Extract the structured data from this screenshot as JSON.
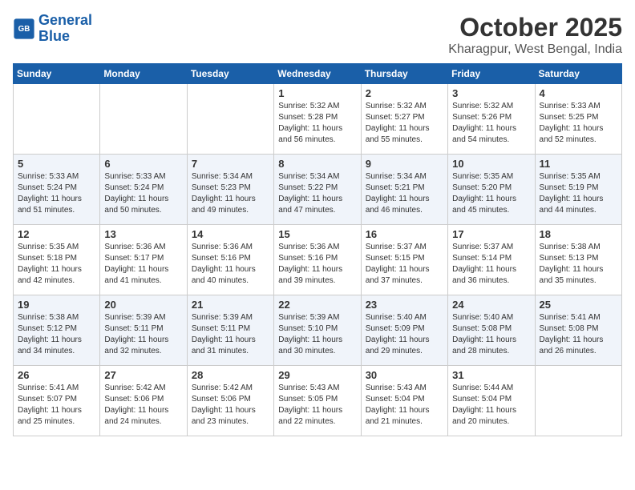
{
  "logo": {
    "text_general": "General",
    "text_blue": "Blue"
  },
  "header": {
    "title": "October 2025",
    "subtitle": "Kharagpur, West Bengal, India"
  },
  "weekdays": [
    "Sunday",
    "Monday",
    "Tuesday",
    "Wednesday",
    "Thursday",
    "Friday",
    "Saturday"
  ],
  "weeks": [
    [
      {
        "day": "",
        "sunrise": "",
        "sunset": "",
        "daylight": ""
      },
      {
        "day": "",
        "sunrise": "",
        "sunset": "",
        "daylight": ""
      },
      {
        "day": "",
        "sunrise": "",
        "sunset": "",
        "daylight": ""
      },
      {
        "day": "1",
        "sunrise": "Sunrise: 5:32 AM",
        "sunset": "Sunset: 5:28 PM",
        "daylight": "Daylight: 11 hours and 56 minutes."
      },
      {
        "day": "2",
        "sunrise": "Sunrise: 5:32 AM",
        "sunset": "Sunset: 5:27 PM",
        "daylight": "Daylight: 11 hours and 55 minutes."
      },
      {
        "day": "3",
        "sunrise": "Sunrise: 5:32 AM",
        "sunset": "Sunset: 5:26 PM",
        "daylight": "Daylight: 11 hours and 54 minutes."
      },
      {
        "day": "4",
        "sunrise": "Sunrise: 5:33 AM",
        "sunset": "Sunset: 5:25 PM",
        "daylight": "Daylight: 11 hours and 52 minutes."
      }
    ],
    [
      {
        "day": "5",
        "sunrise": "Sunrise: 5:33 AM",
        "sunset": "Sunset: 5:24 PM",
        "daylight": "Daylight: 11 hours and 51 minutes."
      },
      {
        "day": "6",
        "sunrise": "Sunrise: 5:33 AM",
        "sunset": "Sunset: 5:24 PM",
        "daylight": "Daylight: 11 hours and 50 minutes."
      },
      {
        "day": "7",
        "sunrise": "Sunrise: 5:34 AM",
        "sunset": "Sunset: 5:23 PM",
        "daylight": "Daylight: 11 hours and 49 minutes."
      },
      {
        "day": "8",
        "sunrise": "Sunrise: 5:34 AM",
        "sunset": "Sunset: 5:22 PM",
        "daylight": "Daylight: 11 hours and 47 minutes."
      },
      {
        "day": "9",
        "sunrise": "Sunrise: 5:34 AM",
        "sunset": "Sunset: 5:21 PM",
        "daylight": "Daylight: 11 hours and 46 minutes."
      },
      {
        "day": "10",
        "sunrise": "Sunrise: 5:35 AM",
        "sunset": "Sunset: 5:20 PM",
        "daylight": "Daylight: 11 hours and 45 minutes."
      },
      {
        "day": "11",
        "sunrise": "Sunrise: 5:35 AM",
        "sunset": "Sunset: 5:19 PM",
        "daylight": "Daylight: 11 hours and 44 minutes."
      }
    ],
    [
      {
        "day": "12",
        "sunrise": "Sunrise: 5:35 AM",
        "sunset": "Sunset: 5:18 PM",
        "daylight": "Daylight: 11 hours and 42 minutes."
      },
      {
        "day": "13",
        "sunrise": "Sunrise: 5:36 AM",
        "sunset": "Sunset: 5:17 PM",
        "daylight": "Daylight: 11 hours and 41 minutes."
      },
      {
        "day": "14",
        "sunrise": "Sunrise: 5:36 AM",
        "sunset": "Sunset: 5:16 PM",
        "daylight": "Daylight: 11 hours and 40 minutes."
      },
      {
        "day": "15",
        "sunrise": "Sunrise: 5:36 AM",
        "sunset": "Sunset: 5:16 PM",
        "daylight": "Daylight: 11 hours and 39 minutes."
      },
      {
        "day": "16",
        "sunrise": "Sunrise: 5:37 AM",
        "sunset": "Sunset: 5:15 PM",
        "daylight": "Daylight: 11 hours and 37 minutes."
      },
      {
        "day": "17",
        "sunrise": "Sunrise: 5:37 AM",
        "sunset": "Sunset: 5:14 PM",
        "daylight": "Daylight: 11 hours and 36 minutes."
      },
      {
        "day": "18",
        "sunrise": "Sunrise: 5:38 AM",
        "sunset": "Sunset: 5:13 PM",
        "daylight": "Daylight: 11 hours and 35 minutes."
      }
    ],
    [
      {
        "day": "19",
        "sunrise": "Sunrise: 5:38 AM",
        "sunset": "Sunset: 5:12 PM",
        "daylight": "Daylight: 11 hours and 34 minutes."
      },
      {
        "day": "20",
        "sunrise": "Sunrise: 5:39 AM",
        "sunset": "Sunset: 5:11 PM",
        "daylight": "Daylight: 11 hours and 32 minutes."
      },
      {
        "day": "21",
        "sunrise": "Sunrise: 5:39 AM",
        "sunset": "Sunset: 5:11 PM",
        "daylight": "Daylight: 11 hours and 31 minutes."
      },
      {
        "day": "22",
        "sunrise": "Sunrise: 5:39 AM",
        "sunset": "Sunset: 5:10 PM",
        "daylight": "Daylight: 11 hours and 30 minutes."
      },
      {
        "day": "23",
        "sunrise": "Sunrise: 5:40 AM",
        "sunset": "Sunset: 5:09 PM",
        "daylight": "Daylight: 11 hours and 29 minutes."
      },
      {
        "day": "24",
        "sunrise": "Sunrise: 5:40 AM",
        "sunset": "Sunset: 5:08 PM",
        "daylight": "Daylight: 11 hours and 28 minutes."
      },
      {
        "day": "25",
        "sunrise": "Sunrise: 5:41 AM",
        "sunset": "Sunset: 5:08 PM",
        "daylight": "Daylight: 11 hours and 26 minutes."
      }
    ],
    [
      {
        "day": "26",
        "sunrise": "Sunrise: 5:41 AM",
        "sunset": "Sunset: 5:07 PM",
        "daylight": "Daylight: 11 hours and 25 minutes."
      },
      {
        "day": "27",
        "sunrise": "Sunrise: 5:42 AM",
        "sunset": "Sunset: 5:06 PM",
        "daylight": "Daylight: 11 hours and 24 minutes."
      },
      {
        "day": "28",
        "sunrise": "Sunrise: 5:42 AM",
        "sunset": "Sunset: 5:06 PM",
        "daylight": "Daylight: 11 hours and 23 minutes."
      },
      {
        "day": "29",
        "sunrise": "Sunrise: 5:43 AM",
        "sunset": "Sunset: 5:05 PM",
        "daylight": "Daylight: 11 hours and 22 minutes."
      },
      {
        "day": "30",
        "sunrise": "Sunrise: 5:43 AM",
        "sunset": "Sunset: 5:04 PM",
        "daylight": "Daylight: 11 hours and 21 minutes."
      },
      {
        "day": "31",
        "sunrise": "Sunrise: 5:44 AM",
        "sunset": "Sunset: 5:04 PM",
        "daylight": "Daylight: 11 hours and 20 minutes."
      },
      {
        "day": "",
        "sunrise": "",
        "sunset": "",
        "daylight": ""
      }
    ]
  ]
}
